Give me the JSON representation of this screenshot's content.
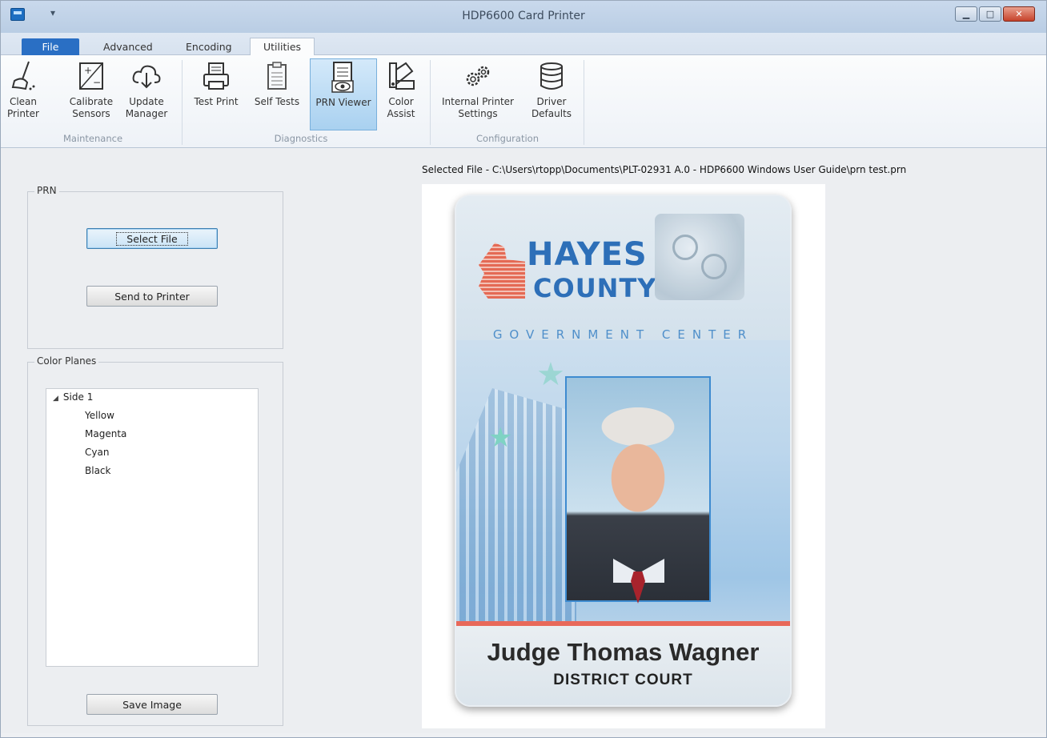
{
  "window": {
    "title": "HDP6600 Card Printer"
  },
  "tabs": [
    {
      "label": "File"
    },
    {
      "label": "Advanced"
    },
    {
      "label": "Encoding"
    },
    {
      "label": "Utilities",
      "active": true
    }
  ],
  "ribbon": {
    "groups": [
      {
        "label": "Maintenance",
        "buttons": [
          {
            "label": "Clean\nPrinter",
            "icon": "broom-icon"
          },
          {
            "label": "Calibrate\nSensors",
            "icon": "calibrate-icon"
          },
          {
            "label": "Update\nManager",
            "icon": "cloud-download-icon"
          }
        ]
      },
      {
        "label": "Diagnostics",
        "buttons": [
          {
            "label": "Test Print",
            "icon": "printer-icon"
          },
          {
            "label": "Self Tests",
            "icon": "clipboard-icon"
          },
          {
            "label": "PRN Viewer",
            "icon": "prn-viewer-icon",
            "active": true
          },
          {
            "label": "Color\nAssist",
            "icon": "color-swatch-icon"
          }
        ]
      },
      {
        "label": "Configuration",
        "buttons": [
          {
            "label": "Internal Printer\nSettings",
            "icon": "gears-icon"
          },
          {
            "label": "Driver\nDefaults",
            "icon": "database-icon"
          }
        ]
      }
    ]
  },
  "prn": {
    "title": "PRN",
    "select_file": "Select File",
    "send_to_printer": "Send to Printer"
  },
  "color_planes": {
    "title": "Color Planes",
    "root": "Side 1",
    "items": [
      "Yellow",
      "Magenta",
      "Cyan",
      "Black"
    ],
    "save_image": "Save Image"
  },
  "selected_file": "Selected File - C:\\Users\\rtopp\\Documents\\PLT-02931 A.0 - HDP6600 Windows User Guide\\prn test.prn",
  "card": {
    "line1": "HAYES",
    "line2": "COUNTY",
    "subtitle": "GOVERNMENT CENTER",
    "name": "Judge Thomas Wagner",
    "department": "DISTRICT COURT"
  },
  "colors": {
    "accent": "#2a6fc4",
    "card_blue": "#2d6fb8",
    "card_red": "#e8695a"
  }
}
